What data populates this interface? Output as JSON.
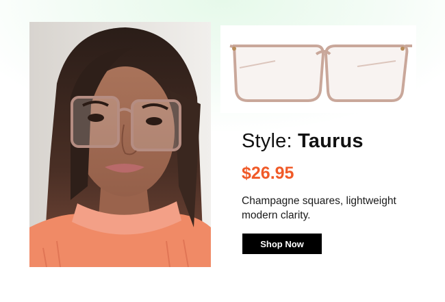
{
  "product": {
    "style_label": "Style:",
    "style_name": "Taurus",
    "price": "$26.95",
    "description": "Champagne squares, lightweight modern clarity.",
    "cta_label": "Shop Now"
  },
  "colors": {
    "price": "#f05a28",
    "button_bg": "#000000",
    "frame_tint": "#c9a79a"
  }
}
